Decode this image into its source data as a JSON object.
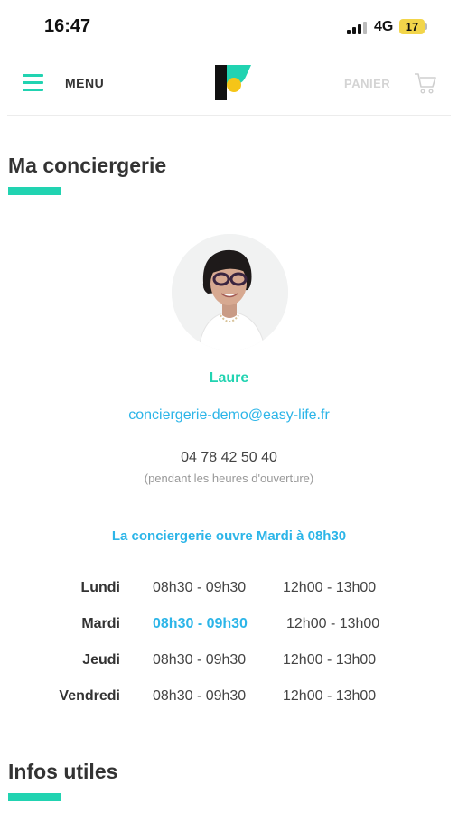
{
  "status_bar": {
    "time": "16:47",
    "network": "4G",
    "battery": "17"
  },
  "header": {
    "menu_label": "MENU",
    "cart_label": "PANIER"
  },
  "page": {
    "title": "Ma conciergerie"
  },
  "concierge": {
    "name": "Laure",
    "email": "conciergerie-demo@easy-life.fr",
    "phone": "04 78 42 50 40",
    "phone_note": "(pendant les heures d'ouverture)"
  },
  "opening_message": "La conciergerie ouvre Mardi à 08h30",
  "schedule": [
    {
      "day": "Lundi",
      "morning": "08h30 - 09h30",
      "afternoon": "12h00 - 13h00"
    },
    {
      "day": "Mardi",
      "morning": "08h30 - 09h30",
      "afternoon": "12h00 - 13h00"
    },
    {
      "day": "Jeudi",
      "morning": "08h30 - 09h30",
      "afternoon": "12h00 - 13h00"
    },
    {
      "day": "Vendredi",
      "morning": "08h30 - 09h30",
      "afternoon": "12h00 - 13h00"
    }
  ],
  "highlighted_day": "Mardi",
  "infos": {
    "title": "Infos utiles"
  },
  "colors": {
    "accent": "#21d3b1",
    "link": "#2cb5e8",
    "logo_yellow": "#f5c518"
  }
}
